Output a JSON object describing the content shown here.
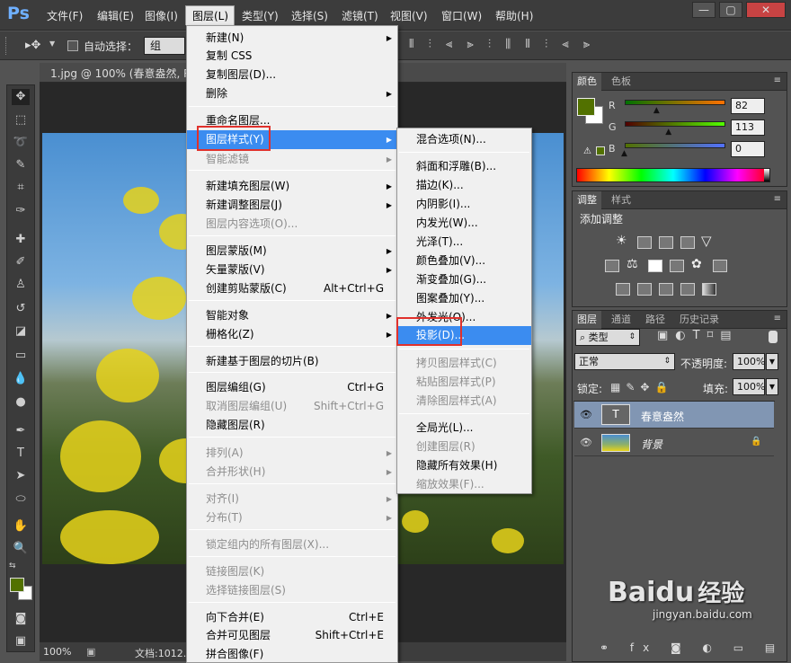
{
  "app": {
    "logo": "Ps"
  },
  "menubar": {
    "items": [
      "文件(F)",
      "编辑(E)",
      "图像(I)",
      "图层(L)",
      "类型(Y)",
      "选择(S)",
      "滤镜(T)",
      "视图(V)",
      "窗口(W)",
      "帮助(H)"
    ]
  },
  "window_buttons": {
    "minimize": "—",
    "maximize": "▢",
    "close": "✕"
  },
  "options": {
    "auto_select_label": "自动选择：",
    "auto_select_value": "组"
  },
  "document": {
    "tab_title": "1.jpg @ 100% (春意盎然, R(",
    "zoom": "100%",
    "doc_info": "文档:1012."
  },
  "layer_menu": {
    "items": [
      {
        "label": "新建(N)",
        "shortcut": "",
        "arrow": true,
        "disabled": false
      },
      {
        "label": "复制 CSS",
        "shortcut": "",
        "arrow": false,
        "disabled": false
      },
      {
        "label": "复制图层(D)...",
        "shortcut": "",
        "arrow": false,
        "disabled": false
      },
      {
        "label": "删除",
        "shortcut": "",
        "arrow": true,
        "disabled": false
      },
      {
        "label": "重命名图层...",
        "shortcut": "",
        "arrow": false,
        "disabled": false
      },
      {
        "label": "图层样式(Y)",
        "shortcut": "",
        "arrow": true,
        "disabled": false,
        "highlight": true
      },
      {
        "label": "智能滤镜",
        "shortcut": "",
        "arrow": true,
        "disabled": true
      },
      {
        "label": "新建填充图层(W)",
        "shortcut": "",
        "arrow": true,
        "disabled": false
      },
      {
        "label": "新建调整图层(J)",
        "shortcut": "",
        "arrow": true,
        "disabled": false
      },
      {
        "label": "图层内容选项(O)...",
        "shortcut": "",
        "arrow": false,
        "disabled": true
      },
      {
        "label": "图层蒙版(M)",
        "shortcut": "",
        "arrow": true,
        "disabled": false
      },
      {
        "label": "矢量蒙版(V)",
        "shortcut": "",
        "arrow": true,
        "disabled": false
      },
      {
        "label": "创建剪贴蒙版(C)",
        "shortcut": "Alt+Ctrl+G",
        "arrow": false,
        "disabled": false
      },
      {
        "label": "智能对象",
        "shortcut": "",
        "arrow": true,
        "disabled": false
      },
      {
        "label": "栅格化(Z)",
        "shortcut": "",
        "arrow": true,
        "disabled": false
      },
      {
        "label": "新建基于图层的切片(B)",
        "shortcut": "",
        "arrow": false,
        "disabled": false
      },
      {
        "label": "图层编组(G)",
        "shortcut": "Ctrl+G",
        "arrow": false,
        "disabled": false
      },
      {
        "label": "取消图层编组(U)",
        "shortcut": "Shift+Ctrl+G",
        "arrow": false,
        "disabled": true
      },
      {
        "label": "隐藏图层(R)",
        "shortcut": "",
        "arrow": false,
        "disabled": false
      },
      {
        "label": "排列(A)",
        "shortcut": "",
        "arrow": true,
        "disabled": true
      },
      {
        "label": "合并形状(H)",
        "shortcut": "",
        "arrow": true,
        "disabled": true
      },
      {
        "label": "对齐(I)",
        "shortcut": "",
        "arrow": true,
        "disabled": true
      },
      {
        "label": "分布(T)",
        "shortcut": "",
        "arrow": true,
        "disabled": true
      },
      {
        "label": "锁定组内的所有图层(X)...",
        "shortcut": "",
        "arrow": false,
        "disabled": true
      },
      {
        "label": "链接图层(K)",
        "shortcut": "",
        "arrow": false,
        "disabled": true
      },
      {
        "label": "选择链接图层(S)",
        "shortcut": "",
        "arrow": false,
        "disabled": true
      },
      {
        "label": "向下合并(E)",
        "shortcut": "Ctrl+E",
        "arrow": false,
        "disabled": false
      },
      {
        "label": "合并可见图层",
        "shortcut": "Shift+Ctrl+E",
        "arrow": false,
        "disabled": false
      },
      {
        "label": "拼合图像(F)",
        "shortcut": "",
        "arrow": false,
        "disabled": false
      }
    ]
  },
  "style_submenu": {
    "items": [
      {
        "label": "混合选项(N)...",
        "disabled": false
      },
      {
        "label": "斜面和浮雕(B)...",
        "disabled": false
      },
      {
        "label": "描边(K)...",
        "disabled": false
      },
      {
        "label": "内阴影(I)...",
        "disabled": false
      },
      {
        "label": "内发光(W)...",
        "disabled": false
      },
      {
        "label": "光泽(T)...",
        "disabled": false
      },
      {
        "label": "颜色叠加(V)...",
        "disabled": false
      },
      {
        "label": "渐变叠加(G)...",
        "disabled": false
      },
      {
        "label": "图案叠加(Y)...",
        "disabled": false
      },
      {
        "label": "外发光(O)...",
        "disabled": false
      },
      {
        "label": "投影(D)...",
        "disabled": false,
        "highlight": true
      },
      {
        "label": "拷贝图层样式(C)",
        "disabled": true
      },
      {
        "label": "粘贴图层样式(P)",
        "disabled": true
      },
      {
        "label": "清除图层样式(A)",
        "disabled": true
      },
      {
        "label": "全局光(L)...",
        "disabled": false
      },
      {
        "label": "创建图层(R)",
        "disabled": true
      },
      {
        "label": "隐藏所有效果(H)",
        "disabled": false
      },
      {
        "label": "缩放效果(F)...",
        "disabled": true
      }
    ]
  },
  "color_panel": {
    "tabs": [
      "颜色",
      "色板"
    ],
    "r_label": "R",
    "g_label": "G",
    "b_label": "B",
    "r": "82",
    "g": "113",
    "b": "0",
    "r_level": 0.32,
    "g_level": 0.44,
    "b_level": 0.0,
    "foreground": "#527100"
  },
  "adjust_panel": {
    "tabs": [
      "调整",
      "样式"
    ],
    "title": "添加调整"
  },
  "layers_panel": {
    "tabs": [
      "图层",
      "通道",
      "路径",
      "历史记录"
    ],
    "filter": "类型",
    "blend": "正常",
    "opacity_label": "不透明度:",
    "opacity": "100%",
    "lock_label": "锁定:",
    "fill_label": "填充:",
    "fill": "100%",
    "layers": [
      {
        "name": "春意盎然",
        "type": "text",
        "selected": true
      },
      {
        "name": "背景",
        "type": "image",
        "selected": false,
        "locked": true
      }
    ]
  },
  "watermark": {
    "brand": "Bai",
    "paw": "du",
    "cn": "经验",
    "url": "jingyan.baidu.com"
  }
}
